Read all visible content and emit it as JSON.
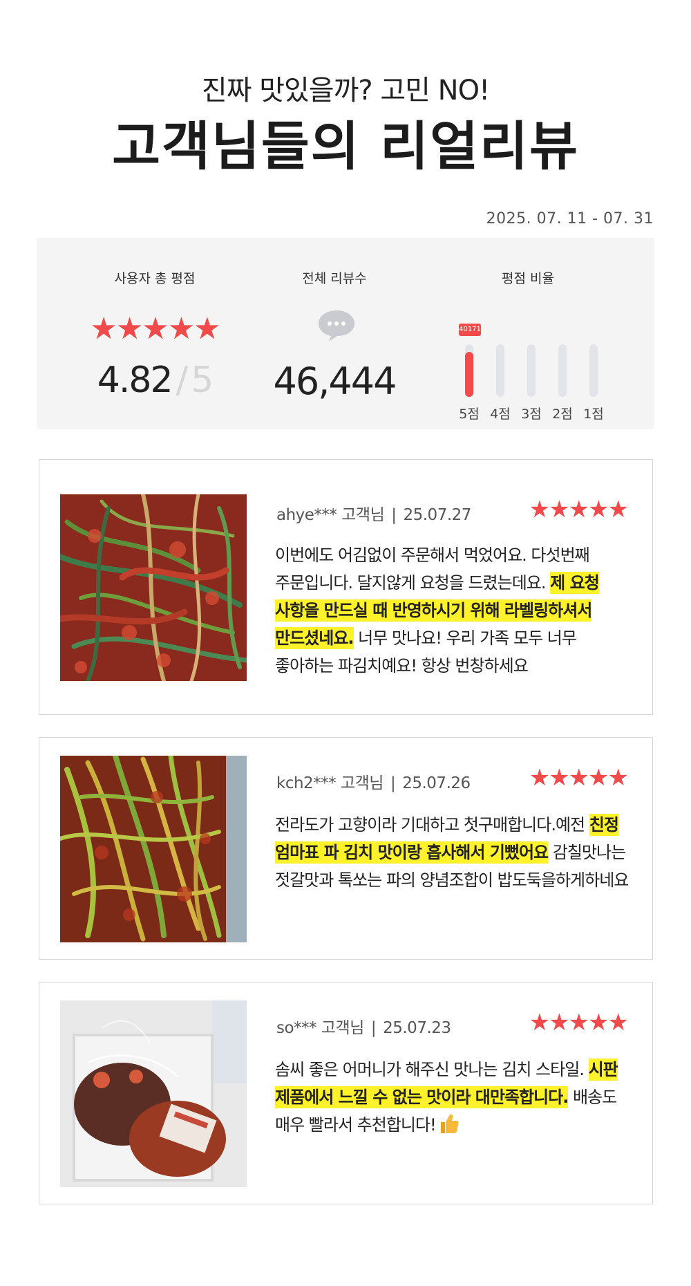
{
  "header": {
    "subtitle": "진짜 맛있을까? 고민 NO!",
    "title": "고객님들의 리얼리뷰"
  },
  "period": "2025. 07. 11 - 07. 31",
  "summary": {
    "rating_label": "사용자 총 평점",
    "rating_value": "4.82",
    "rating_sep": "/",
    "rating_max": "5",
    "rating_stars": "★★★★★",
    "count_label": "전체 리뷰수",
    "count_value": "46,444",
    "ratio_label": "평점 비율",
    "ratio": [
      {
        "label": "5점",
        "count": "40171",
        "fraction": 0.86
      },
      {
        "label": "4점",
        "fraction": 0
      },
      {
        "label": "3점",
        "fraction": 0
      },
      {
        "label": "2점",
        "fraction": 0
      },
      {
        "label": "1점",
        "fraction": 0
      }
    ],
    "accent_color": "#f04a4a"
  },
  "reviews": [
    {
      "user": "ahye*** 고객님",
      "date": "25.07.27",
      "stars": "★★★★★",
      "text_before": "이번에도 어김없이 주문해서 먹었어요. 다섯번째 주문입니다. 달지않게 요청을 드렸는데요. ",
      "highlight": "제 요청 사항을 만드실 때 반영하시기 위해 라벨링하셔서 만드셨네요.",
      "text_after": " 너무 맛나요! 우리 가족 모두 너무 좋아하는 파김치예요! 항상 번창하세요"
    },
    {
      "user": "kch2*** 고객님",
      "date": "25.07.26",
      "stars": "★★★★★",
      "text_before": "전라도가 고향이라 기대하고 첫구매합니다.예전 ",
      "highlight": "친정 엄마표 파 김치 맛이랑 흡사해서 기뻤어요",
      "text_after": " 감칠맛나는 젓갈맛과 톡쏘는 파의 양념조합이 밥도둑을하게하네요"
    },
    {
      "user": "so*** 고객님",
      "date": "25.07.23",
      "stars": "★★★★★",
      "text_before": "솜씨 좋은 어머니가 해주신 맛나는 김치 스타일. ",
      "highlight": "시판 제품에서 느낄 수 없는 맛이라 대만족합니다.",
      "text_after": " 배송도 매우 빨라서 추천합니다!"
    }
  ]
}
